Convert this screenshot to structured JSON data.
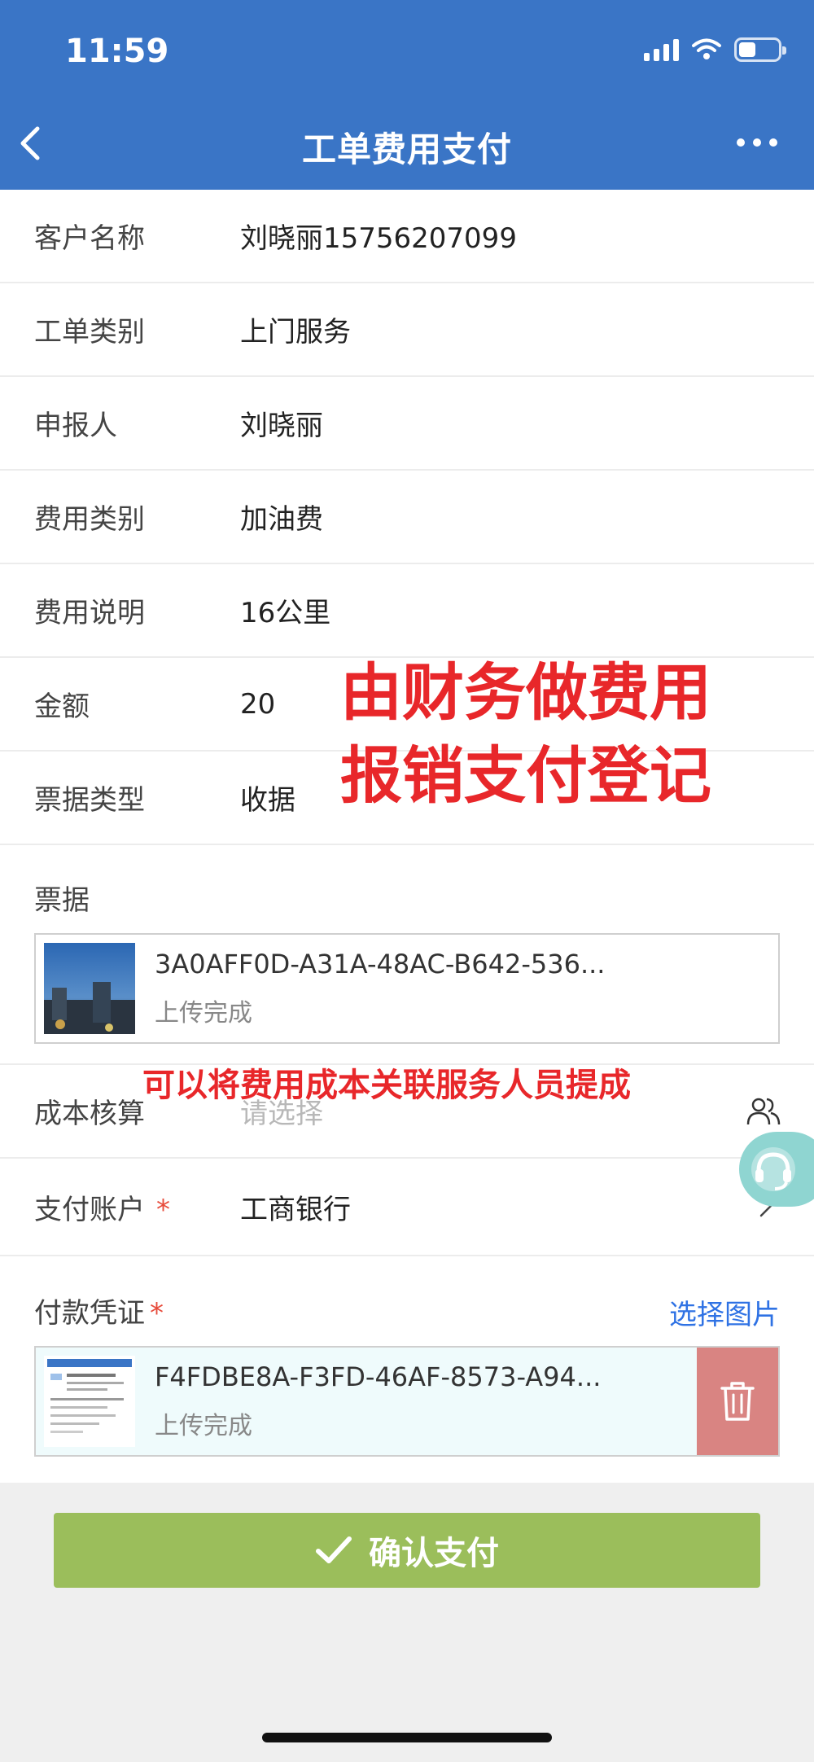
{
  "status_bar": {
    "time": "11:59"
  },
  "header": {
    "title": "工单费用支付"
  },
  "fields": [
    {
      "label": "客户名称",
      "value": "刘晓丽15756207099"
    },
    {
      "label": "工单类别",
      "value": "上门服务"
    },
    {
      "label": "申报人",
      "value": "刘晓丽"
    },
    {
      "label": "费用类别",
      "value": "加油费"
    },
    {
      "label": "费用说明",
      "value": "16公里"
    },
    {
      "label": "金额",
      "value": "20"
    },
    {
      "label": "票据类型",
      "value": "收据"
    }
  ],
  "receipt": {
    "label": "票据",
    "file_name": "3A0AFF0D-A31A-48AC-B642-536...",
    "file_status": "上传完成"
  },
  "cost_accounting": {
    "label": "成本核算",
    "placeholder": "请选择"
  },
  "payment_account": {
    "label": "支付账户",
    "required_mark": "*",
    "value": "工商银行"
  },
  "payment_voucher": {
    "label": "付款凭证",
    "required_mark": "*",
    "choose_label": "选择图片",
    "file_name": "F4FDBE8A-F3FD-46AF-8573-A94...",
    "file_status": "上传完成"
  },
  "annotations": {
    "finance_note_line1": "由财务做费用",
    "finance_note_line2": "报销支付登记",
    "cost_note": "可以将费用成本关联服务人员提成"
  },
  "confirm_button": {
    "label": "确认支付"
  },
  "colors": {
    "header": "#3a75c6",
    "confirm": "#9bbe5b",
    "annotation": "#e8272a",
    "link": "#2f72e4",
    "delete": "#d98482"
  }
}
